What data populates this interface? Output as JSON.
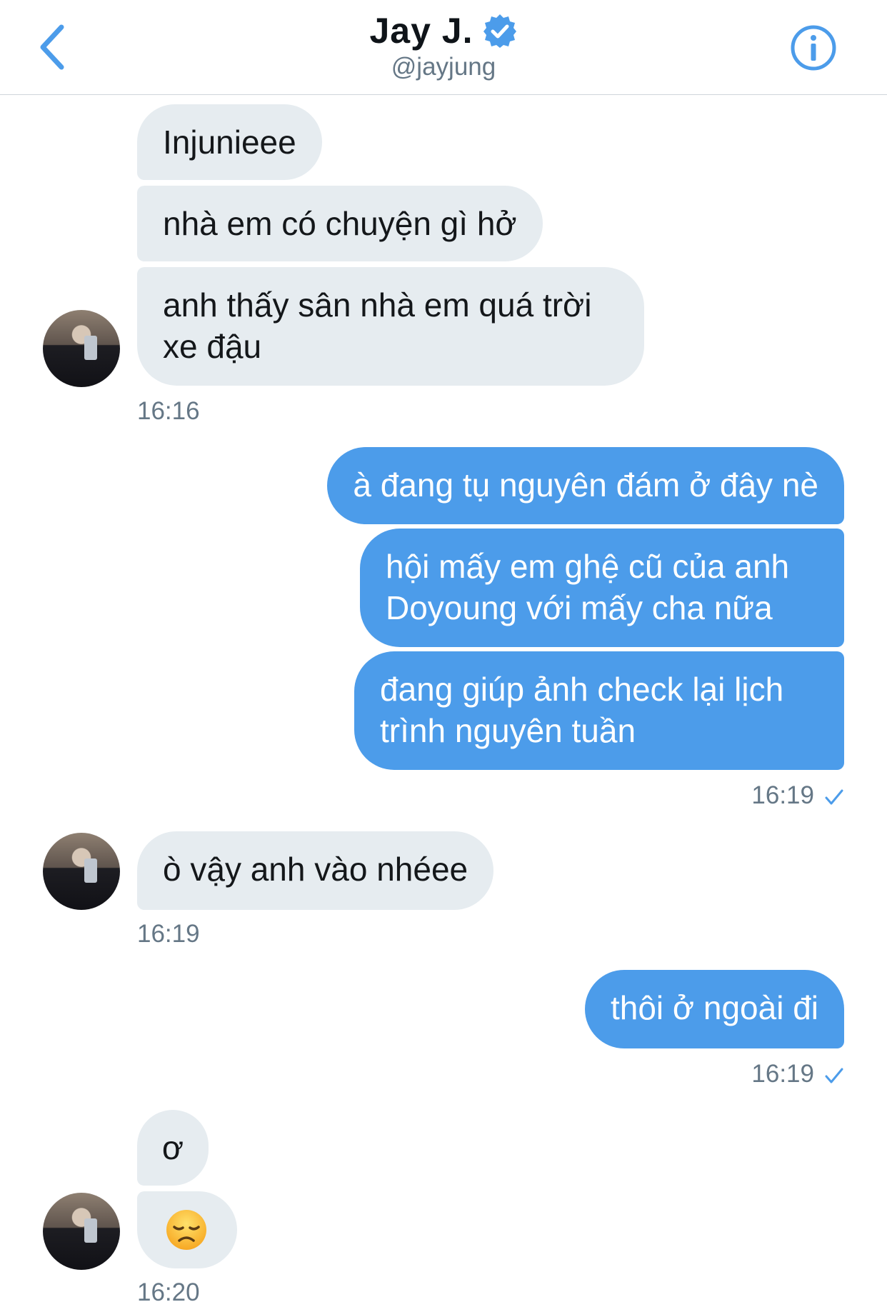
{
  "header": {
    "name": "Jay J.",
    "handle": "@jayjung",
    "back_icon": "chevron-left-icon",
    "verified_icon": "verified-badge-icon",
    "info_icon": "info-icon"
  },
  "colors": {
    "accent": "#4c9cea",
    "incoming_bubble": "#e6ecf0",
    "timestamp": "#657786"
  },
  "messages": {
    "g1": {
      "m1": "Injunieee",
      "m2": "nhà em có chuyện gì hở",
      "m3": "anh thấy sân nhà em quá trời xe đậu",
      "time": "16:16"
    },
    "g2": {
      "m1": "à đang tụ nguyên đám ở đây nè",
      "m2": "hội mấy em ghệ cũ của anh Doyoung với mấy cha nữa",
      "m3": "đang giúp ảnh check lại lịch trình nguyên tuần",
      "time": "16:19"
    },
    "g3": {
      "m1": "ò vậy anh vào nhéee",
      "time": "16:19"
    },
    "g4": {
      "m1": "thôi ở ngoài đi",
      "time": "16:19"
    },
    "g5": {
      "m1": "ơ",
      "m2_emoji": "disappointed-face-emoji",
      "time": "16:20"
    }
  }
}
